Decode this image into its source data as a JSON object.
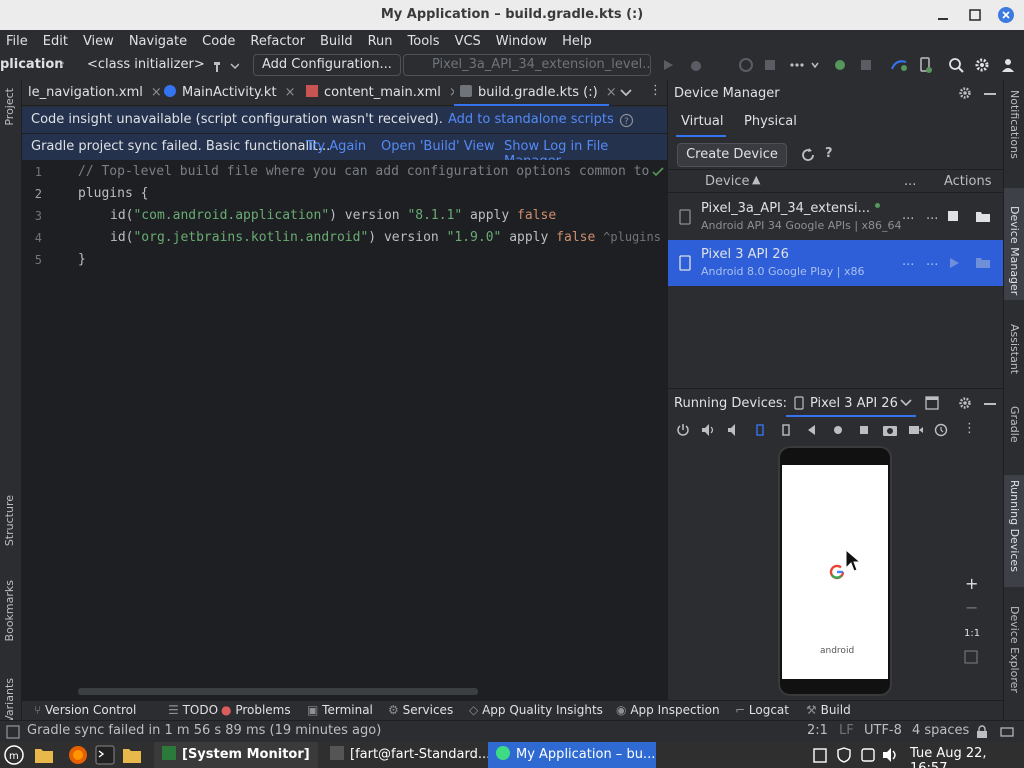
{
  "window": {
    "title": "My Application – build.gradle.kts (:)"
  },
  "menu": [
    "File",
    "Edit",
    "View",
    "Navigate",
    "Code",
    "Refactor",
    "Build",
    "Run",
    "Tools",
    "VCS",
    "Window",
    "Help"
  ],
  "toolbar": {
    "project_crumb": "plication",
    "class_crumb": "<class initializer>",
    "add_configuration": "Add Configuration...",
    "device_selector": "Pixel_3a_API_34_extension_level..."
  },
  "left_tools": [
    "Project",
    "Structure",
    "Bookmarks",
    "Build Variants"
  ],
  "tabs": [
    {
      "label": "le_navigation.xml"
    },
    {
      "label": "MainActivity.kt"
    },
    {
      "label": "content_main.xml"
    },
    {
      "label": "build.gradle.kts (:)"
    }
  ],
  "banner1": {
    "message": "Code insight unavailable (script configuration wasn't received).",
    "link": "Add to standalone scripts"
  },
  "banner2": {
    "message": "Gradle project sync failed. Basic functionalit...",
    "try_again": "Try Again",
    "open_build": "Open 'Build' View",
    "show_log": "Show Log in File Manager"
  },
  "editor": {
    "line_numbers": [
      "1",
      "2",
      "3",
      "4",
      "5"
    ],
    "line1": "// Top-level build file where you can add configuration options common to",
    "line2": "plugins {",
    "l3_a": "id(",
    "l3_str": "\"com.android.application\"",
    "l3_b": ") version ",
    "l3_ver": "\"8.1.1\"",
    "l3_c": " apply ",
    "l3_kw": "false",
    "l4_a": "id(",
    "l4_str": "\"org.jetbrains.kotlin.android\"",
    "l4_b": ") version ",
    "l4_ver": "\"1.9.0\"",
    "l4_c": " apply ",
    "l4_kw": "false",
    "l4_hint": "^plugins",
    "line5": "}"
  },
  "device_manager": {
    "title": "Device Manager",
    "tab_virtual": "Virtual",
    "tab_physical": "Physical",
    "create_device": "Create Device",
    "col_device": "Device",
    "col_dots": "...",
    "col_actions": "Actions",
    "devices": [
      {
        "name": "Pixel_3a_API_34_extensi...",
        "sub": "Android API 34 Google APIs | x86_64"
      },
      {
        "name": "Pixel 3 API 26",
        "sub": "Android 8.0 Google Play | x86"
      }
    ]
  },
  "running_devices": {
    "label": "Running Devices:",
    "device": "Pixel 3 API 26",
    "android_text": "android",
    "zoom_label": "1:1"
  },
  "right_tools": [
    "Notifications",
    "Device Manager",
    "Assistant",
    "Gradle",
    "Running Devices",
    "Device Explorer"
  ],
  "bottom_tabs": [
    "Version Control",
    "TODO",
    "Problems",
    "Terminal",
    "Services",
    "App Quality Insights",
    "App Inspection",
    "Logcat",
    "Build"
  ],
  "status": {
    "message": "Gradle sync failed in 1 m 56 s 89 ms (19 minutes ago)",
    "position": "2:1",
    "line_ending": "LF",
    "encoding": "UTF-8",
    "indent": "4 spaces"
  },
  "taskbar": {
    "system_monitor": "[System Monitor]",
    "terminal": "[fart@fart-Standard...",
    "app": "My Application – bu...",
    "clock": "Tue Aug 22, 16:57"
  },
  "colors": {
    "accent": "#3574f0",
    "selection": "#2e5fd8",
    "banner": "#25324d",
    "editor_bg": "#1e1f22"
  }
}
